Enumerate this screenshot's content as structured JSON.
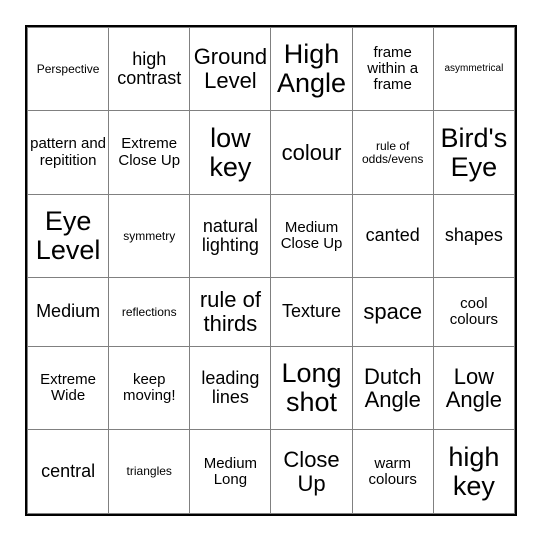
{
  "card": {
    "type": "bingo-card",
    "columns": 6,
    "rows": 6,
    "border_color": "#000000",
    "grid_line_color": "#808080",
    "background_color": "#ffffff",
    "text_color": "#000000",
    "cells": [
      [
        {
          "text": "Perspective",
          "size": "sm"
        },
        {
          "text": "high contrast",
          "size": "lg"
        },
        {
          "text": "Ground Level",
          "size": "xl"
        },
        {
          "text": "High Angle",
          "size": "xxl"
        },
        {
          "text": "frame within a frame",
          "size": "md"
        },
        {
          "text": "asymmetrical",
          "size": "xs"
        }
      ],
      [
        {
          "text": "pattern and repitition",
          "size": "md"
        },
        {
          "text": "Extreme Close Up",
          "size": "md"
        },
        {
          "text": "low key",
          "size": "xxl"
        },
        {
          "text": "colour",
          "size": "xl"
        },
        {
          "text": "rule of odds/evens",
          "size": "sm"
        },
        {
          "text": "Bird's Eye",
          "size": "xxl"
        }
      ],
      [
        {
          "text": "Eye Level",
          "size": "xxl"
        },
        {
          "text": "symmetry",
          "size": "sm"
        },
        {
          "text": "natural lighting",
          "size": "lg"
        },
        {
          "text": "Medium Close Up",
          "size": "md"
        },
        {
          "text": "canted",
          "size": "lg"
        },
        {
          "text": "shapes",
          "size": "lg"
        }
      ],
      [
        {
          "text": "Medium",
          "size": "lg"
        },
        {
          "text": "reflections",
          "size": "sm"
        },
        {
          "text": "rule of thirds",
          "size": "xl"
        },
        {
          "text": "Texture",
          "size": "lg"
        },
        {
          "text": "space",
          "size": "xl"
        },
        {
          "text": "cool colours",
          "size": "md"
        }
      ],
      [
        {
          "text": "Extreme Wide",
          "size": "md"
        },
        {
          "text": "keep moving!",
          "size": "md"
        },
        {
          "text": "leading lines",
          "size": "lg"
        },
        {
          "text": "Long shot",
          "size": "xxl"
        },
        {
          "text": "Dutch Angle",
          "size": "xl"
        },
        {
          "text": "Low Angle",
          "size": "xl"
        }
      ],
      [
        {
          "text": "central",
          "size": "lg"
        },
        {
          "text": "triangles",
          "size": "sm"
        },
        {
          "text": "Medium Long",
          "size": "md"
        },
        {
          "text": "Close Up",
          "size": "xl"
        },
        {
          "text": "warm colours",
          "size": "md"
        },
        {
          "text": "high key",
          "size": "xxl"
        }
      ]
    ]
  }
}
